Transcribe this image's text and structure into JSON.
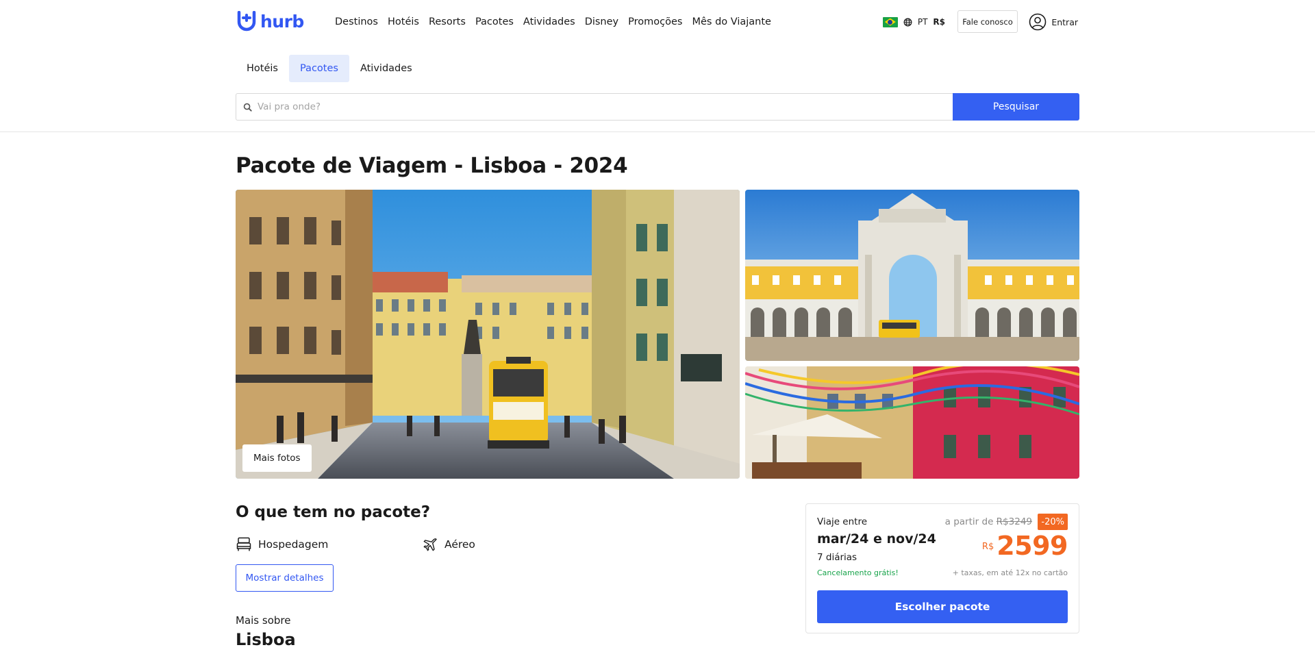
{
  "header": {
    "logo_text": "hurb",
    "nav": [
      "Destinos",
      "Hotéis",
      "Resorts",
      "Pacotes",
      "Atividades",
      "Disney",
      "Promoções",
      "Mês do Viajante"
    ],
    "language": "PT",
    "currency": "R$",
    "contact_label": "Fale conosco",
    "login_label": "Entrar"
  },
  "product_tabs": [
    {
      "label": "Hotéis",
      "active": false
    },
    {
      "label": "Pacotes",
      "active": true
    },
    {
      "label": "Atividades",
      "active": false
    }
  ],
  "search": {
    "placeholder": "Vai pra onde?",
    "button_label": "Pesquisar"
  },
  "page": {
    "title": "Pacote de Viagem - Lisboa - 2024",
    "more_photos_label": "Mais fotos"
  },
  "included": {
    "title": "O que tem no pacote?",
    "items": [
      {
        "label": "Hospedagem",
        "icon": "bed-icon"
      },
      {
        "label": "Aéreo",
        "icon": "plane-icon"
      }
    ],
    "details_button": "Mostrar detalhes"
  },
  "about": {
    "prefix": "Mais sobre",
    "city": "Lisboa"
  },
  "offer": {
    "travel_label": "Viaje entre",
    "dates": "mar/24 e nov/24",
    "nights": "7 diárias",
    "cancellation": "Cancelamento grátis!",
    "from_label": "a partir de",
    "old_price": "R$3249",
    "discount": "-20%",
    "currency": "R$",
    "price": "2599",
    "taxes_note": "+ taxas, em até 12x no cartão",
    "cta": "Escolher pacote"
  },
  "colors": {
    "brand_blue": "#3257f2",
    "offer_orange": "#f26822",
    "success_green": "#17a34a",
    "active_tab_bg": "#e5ecfc"
  }
}
